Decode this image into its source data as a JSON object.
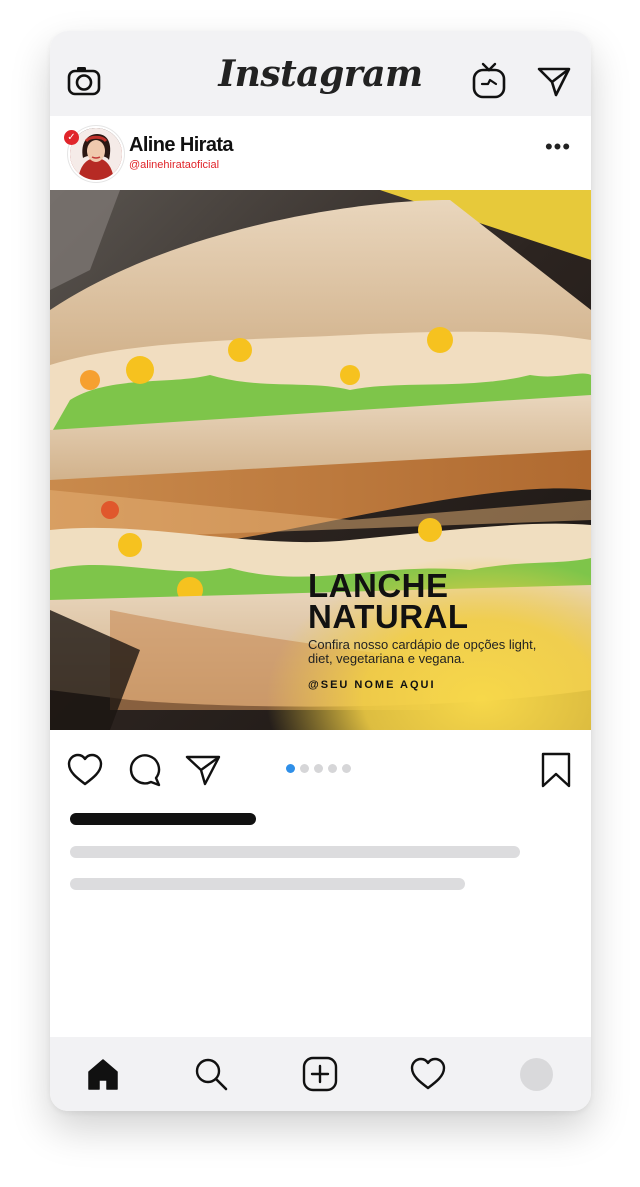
{
  "app": {
    "brand": "Instagram"
  },
  "topbar": {
    "left_icon": "camera-icon",
    "right_icons": [
      "igtv-icon",
      "direct-message-icon"
    ]
  },
  "post": {
    "username": "Aline Hirata",
    "handle": "@alinehirataoficial",
    "verified": true,
    "verified_color": "#e0242a",
    "more_label": "•••",
    "image": {
      "headline": "LANCHE\nNATURAL",
      "description": "Confira nosso cardápio de opções light, diet, vegetariana e vegana.",
      "signature": "@SEU NOME AQUI",
      "accent_color": "#f6d64a"
    },
    "carousel": {
      "count": 5,
      "active_index": 0,
      "active_color": "#2f8fe8"
    }
  },
  "actions": {
    "icons": [
      "heart-icon",
      "comment-icon",
      "share-icon",
      "bookmark-icon"
    ]
  },
  "bottom_nav": {
    "icons": [
      "home-icon",
      "search-icon",
      "add-post-icon",
      "activity-heart-icon",
      "profile-avatar"
    ]
  }
}
